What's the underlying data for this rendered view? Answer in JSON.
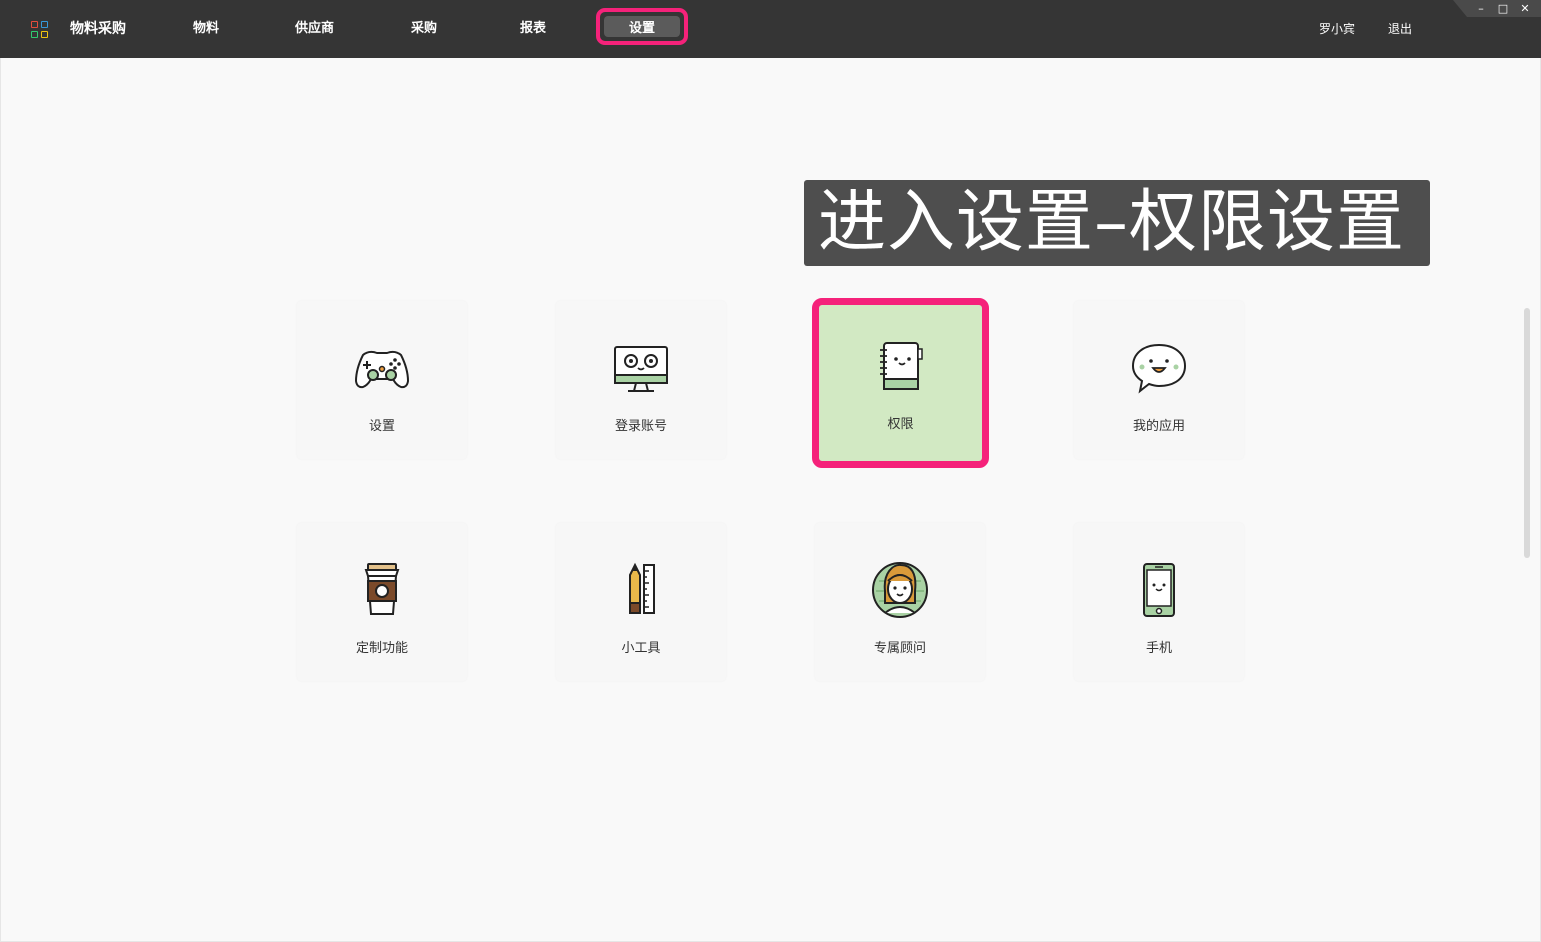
{
  "app": {
    "title": "物料采购"
  },
  "nav": {
    "items": [
      "物料",
      "供应商",
      "采购",
      "报表"
    ],
    "active": "设置"
  },
  "user": {
    "name": "罗小宾",
    "logout": "退出"
  },
  "window_controls": {
    "minimize": "–",
    "maximize": "□",
    "close": "✕"
  },
  "overlay": {
    "title": "进入设置–权限设置"
  },
  "tiles": [
    {
      "label": "设置",
      "icon": "gamepad-icon"
    },
    {
      "label": "登录账号",
      "icon": "monitor-icon"
    },
    {
      "label": "权限",
      "icon": "notebook-icon",
      "selected": true
    },
    {
      "label": "我的应用",
      "icon": "speech-bubble-icon"
    },
    {
      "label": "定制功能",
      "icon": "coffee-cup-icon"
    },
    {
      "label": "小工具",
      "icon": "pencil-ruler-icon"
    },
    {
      "label": "专属顾问",
      "icon": "advisor-avatar-icon"
    },
    {
      "label": "手机",
      "icon": "phone-icon"
    }
  ],
  "colors": {
    "topbar": "#353535",
    "highlight": "#f5227a",
    "selected_tile": "#d2e9c3",
    "icon_green": "#a9d2a4",
    "logo": [
      "#e74c3c",
      "#f1c40f",
      "#2ecc71",
      "#3498db"
    ]
  }
}
